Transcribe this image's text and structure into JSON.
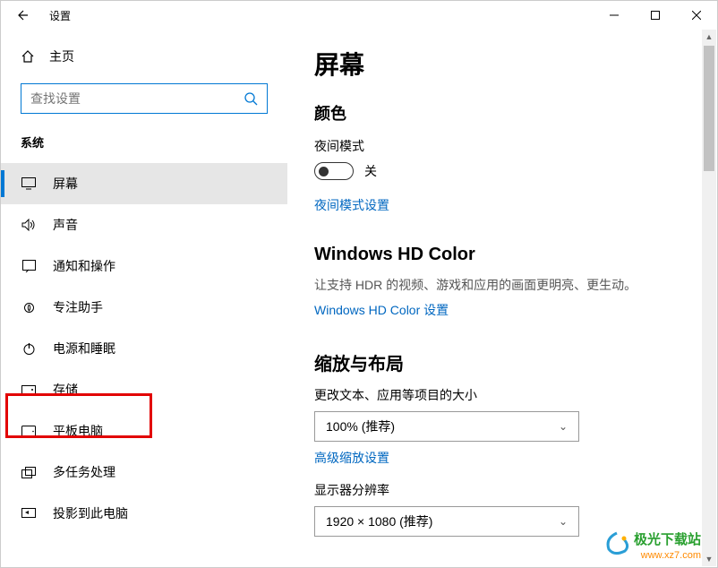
{
  "window": {
    "title": "设置"
  },
  "sidebar": {
    "home": "主页",
    "search_placeholder": "查找设置",
    "section": "系统",
    "items": [
      {
        "label": "屏幕"
      },
      {
        "label": "声音"
      },
      {
        "label": "通知和操作"
      },
      {
        "label": "专注助手"
      },
      {
        "label": "电源和睡眠"
      },
      {
        "label": "存储"
      },
      {
        "label": "平板电脑"
      },
      {
        "label": "多任务处理"
      },
      {
        "label": "投影到此电脑"
      }
    ]
  },
  "main": {
    "title": "屏幕",
    "color_heading": "颜色",
    "night_mode_label": "夜间模式",
    "night_mode_state": "关",
    "night_mode_link": "夜间模式设置",
    "hdcolor_heading": "Windows HD Color",
    "hdcolor_desc": "让支持 HDR 的视频、游戏和应用的画面更明亮、更生动。",
    "hdcolor_link": "Windows HD Color 设置",
    "scale_heading": "缩放与布局",
    "scale_label": "更改文本、应用等项目的大小",
    "scale_value": "100% (推荐)",
    "scale_link": "高级缩放设置",
    "resolution_label": "显示器分辨率",
    "resolution_value": "1920 × 1080 (推荐)"
  },
  "watermark": {
    "line1": "极光下载站",
    "line2": "www.xz7.com"
  }
}
